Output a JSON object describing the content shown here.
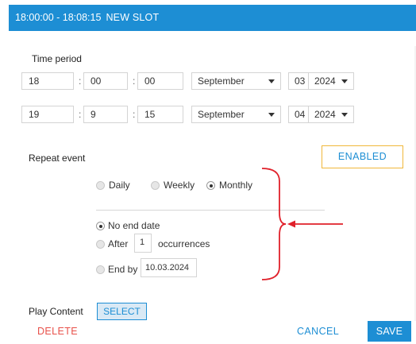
{
  "dialog": {
    "title_time": "18:00:00 - 18:08:15",
    "title_name": "NEW SLOT"
  },
  "time_period": {
    "label": "Time period",
    "start": {
      "hour": "18",
      "minute": "00",
      "second": "00",
      "month": "September",
      "day": "03",
      "year": "2024"
    },
    "end": {
      "hour": "19",
      "minute": "9",
      "second": "15",
      "month": "September",
      "day": "04",
      "year": "2024"
    },
    "separator": ":"
  },
  "repeat": {
    "label": "Repeat event",
    "toggle_label": "ENABLED",
    "frequency": [
      {
        "label": "Daily",
        "checked": false
      },
      {
        "label": "Weekly",
        "checked": false
      },
      {
        "label": "Monthly",
        "checked": true
      }
    ],
    "end_options": {
      "no_end_label": "No end date",
      "after_label": "After",
      "after_value": "1",
      "occurrences_label": "occurrences",
      "end_by_label": "End by",
      "end_by_value": "10.03.2024",
      "selected": "No end date"
    }
  },
  "play_content": {
    "label": "Play Content",
    "select_label": "SELECT"
  },
  "footer": {
    "delete_label": "DELETE",
    "cancel_label": "CANCEL",
    "save_label": "SAVE"
  },
  "colors": {
    "accent": "#1d8ed4",
    "enabled_border": "#f0b73a",
    "delete": "#e8514a",
    "annotation": "#e0202a"
  },
  "icons": {
    "dropdown": "caret-down-icon",
    "annotation_bracket": "bracket-annotation",
    "annotation_arrow": "arrow-left-annotation"
  }
}
